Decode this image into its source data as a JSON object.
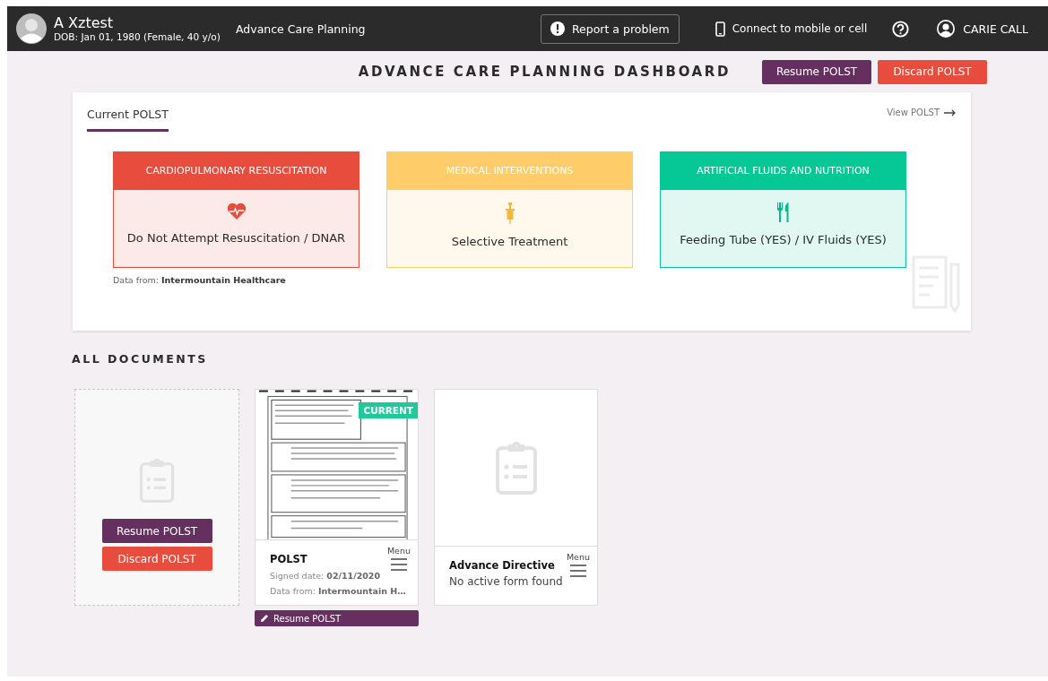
{
  "header": {
    "patient_name": "A Xztest",
    "patient_info": "DOB: Jan 01, 1980 (Female, 40 y/o)",
    "app_title": "Advance Care Planning",
    "report_button": "Report a problem",
    "connect_link": "Connect to mobile or cell",
    "user_name": "CARIE CALL"
  },
  "dashboard": {
    "title": "ADVANCE CARE PLANNING DASHBOARD",
    "buttons": [
      {
        "label": "Resume POLST",
        "kind": "resume"
      },
      {
        "label": "Discard POLST",
        "kind": "discard"
      }
    ]
  },
  "current_polst": {
    "title": "Current POLST",
    "view_link": "View POLST",
    "sections": [
      {
        "heading": "CARDIOPULMONARY RESUSCITATION",
        "value": "Do Not Attempt Resuscitation / DNAR",
        "kind": "cpr",
        "color": "#e84c3d"
      },
      {
        "heading": "MEDICAL INTERVENTIONS",
        "value": "Selective Treatment",
        "kind": "interventions",
        "color": "#fecd6a"
      },
      {
        "heading": "ARTIFICIAL FLUIDS AND NUTRITION",
        "value": "Feeding Tube (YES) / IV Fluids (YES)",
        "kind": "nutrition",
        "color": "#05c896"
      }
    ],
    "source": "Data from: **Intermountain Healthcare**"
  },
  "all_documents": {
    "title": "ALL DOCUMENTS",
    "documents": [
      {
        "kind": "draft",
        "buttons": [
          {
            "label": "Resume POLST",
            "kind": "resume"
          },
          {
            "label": "Discard POLST",
            "kind": "discard"
          }
        ]
      },
      {
        "kind": "form",
        "badge": "CURRENT",
        "title": "POLST",
        "signed": "Signed date: **02/11/2020**",
        "source": "Data from: **Intermountain H…**",
        "menu_label": "Menu",
        "action": "Resume POLST"
      },
      {
        "kind": "empty",
        "title": "Advance Directive",
        "status": "No active form found",
        "menu_label": "Menu"
      }
    ]
  }
}
